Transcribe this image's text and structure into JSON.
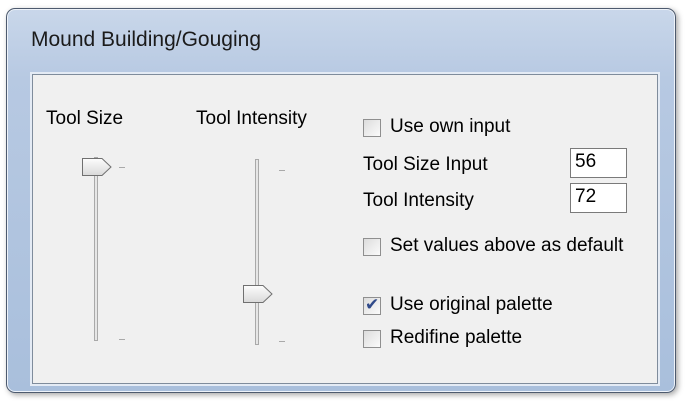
{
  "window": {
    "title": "Mound Building/Gouging"
  },
  "sliders": {
    "size": {
      "label": "Tool Size",
      "value_fraction": 0.0
    },
    "intensity": {
      "label": "Tool Intensity",
      "value_fraction": 0.72
    }
  },
  "options": {
    "use_own_input": {
      "label": "Use own input",
      "checked": false
    },
    "tool_size_input": {
      "label": "Tool Size Input",
      "value": "56"
    },
    "tool_intensity_input": {
      "label": "Tool Intensity",
      "value": "72"
    },
    "set_default": {
      "label": "Set values above as default",
      "checked": false
    },
    "use_original_palette": {
      "label": "Use original palette",
      "checked": true
    },
    "redefine_palette": {
      "label": "Redifine palette",
      "checked": false
    }
  },
  "colors": {
    "frame": "#b7c9e2",
    "client": "#f0f0f0",
    "check": "#304a8a"
  }
}
